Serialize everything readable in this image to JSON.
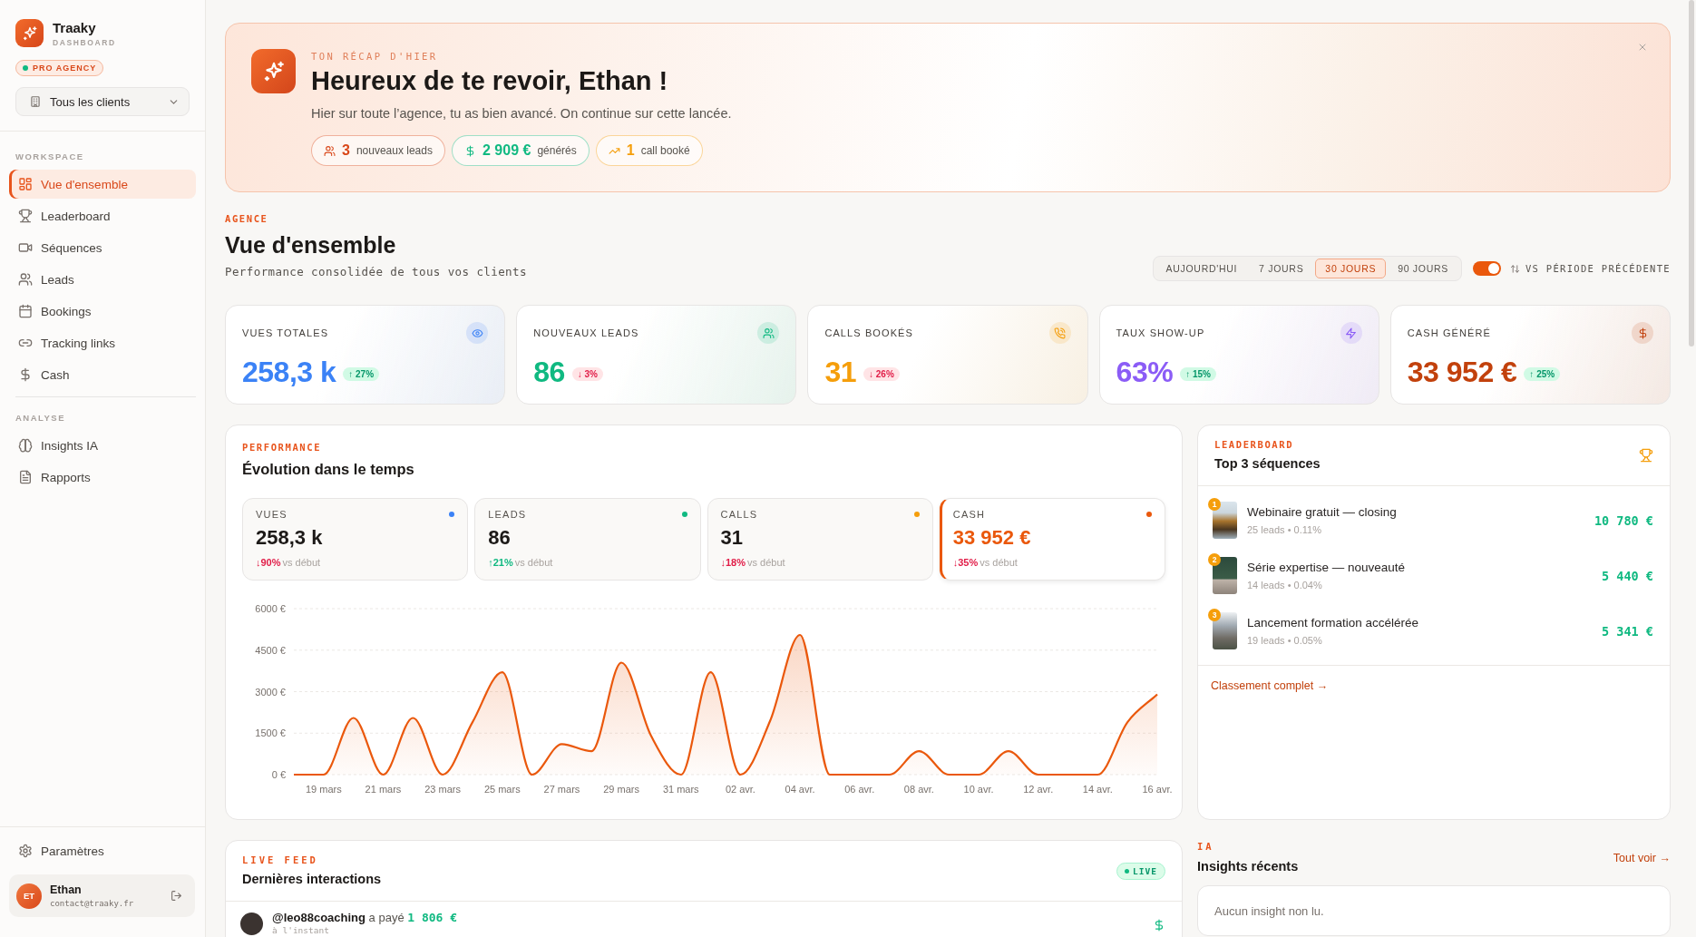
{
  "sidebar": {
    "brand": {
      "name": "Traaky",
      "subtitle": "DASHBOARD"
    },
    "plan_badge": "PRO AGENCY",
    "client_select": {
      "value": "Tous les clients"
    },
    "sections": [
      {
        "title": "WORKSPACE",
        "items": [
          {
            "label": "Vue d'ensemble",
            "selected": true
          },
          {
            "label": "Leaderboard",
            "selected": false
          },
          {
            "label": "Séquences",
            "selected": false
          },
          {
            "label": "Leads",
            "selected": false
          },
          {
            "label": "Bookings",
            "selected": false
          },
          {
            "label": "Tracking links",
            "selected": false
          },
          {
            "label": "Cash",
            "selected": false
          }
        ]
      },
      {
        "title": "ANALYSE",
        "items": [
          {
            "label": "Insights IA",
            "selected": false
          },
          {
            "label": "Rapports",
            "selected": false
          }
        ]
      }
    ],
    "settings": "Paramètres",
    "user": {
      "initials": "ET",
      "name": "Ethan",
      "email": "contact@traaky.fr"
    }
  },
  "banner": {
    "eyebrow": "TON RÉCAP D'HIER",
    "title": "Heureux de te revoir, Ethan !",
    "subtitle": "Hier sur toute l’agence, tu as bien avancé. On continue sur cette lancée.",
    "chips": [
      {
        "value": "3",
        "label": "nouveaux leads",
        "color": "#d9481a"
      },
      {
        "value": "2 909 €",
        "label": "générés",
        "color": "#10b981"
      },
      {
        "value": "1",
        "label": "call booké",
        "color": "#f59e0b"
      }
    ]
  },
  "header": {
    "eyebrow": "AGENCE",
    "title": "Vue d'ensemble",
    "subtitle": "Performance consolidée de tous vos clients",
    "periods": [
      {
        "label": "AUJOURD'HUI",
        "selected": false
      },
      {
        "label": "7 JOURS",
        "selected": false
      },
      {
        "label": "30 JOURS",
        "selected": true
      },
      {
        "label": "90 JOURS",
        "selected": false
      }
    ],
    "compare": {
      "on": true,
      "label": "VS PÉRIODE PRÉCÉDENTE"
    }
  },
  "kpis": [
    {
      "label": "VUES TOTALES",
      "value": "258,3 k",
      "delta": "↑ 27%",
      "positive": true,
      "color": "#3b82f6"
    },
    {
      "label": "NOUVEAUX LEADS",
      "value": "86",
      "delta": "↓ 3%",
      "positive": false,
      "color": "#10b981"
    },
    {
      "label": "CALLS BOOKÉS",
      "value": "31",
      "delta": "↓ 26%",
      "positive": false,
      "color": "#f59e0b"
    },
    {
      "label": "TAUX SHOW-UP",
      "value": "63%",
      "delta": "↑ 15%",
      "positive": true,
      "color": "#8b5cf6"
    },
    {
      "label": "CASH GÉNÉRÉ",
      "value": "33 952 €",
      "delta": "↑ 25%",
      "positive": true,
      "color": "#c2410c"
    }
  ],
  "performance": {
    "eyebrow": "PERFORMANCE",
    "title": "Évolution dans le temps",
    "metrics": [
      {
        "label": "VUES",
        "value": "258,3 k",
        "delta": "↓90%",
        "positive": false,
        "note": "vs début",
        "color": "#3b82f6",
        "selected": false
      },
      {
        "label": "LEADS",
        "value": "86",
        "delta": "↑21%",
        "positive": true,
        "note": "vs début",
        "color": "#10b981",
        "selected": false
      },
      {
        "label": "CALLS",
        "value": "31",
        "delta": "↓18%",
        "positive": false,
        "note": "vs début",
        "color": "#f59e0b",
        "selected": false
      },
      {
        "label": "CASH",
        "value": "33 952 €",
        "delta": "↓35%",
        "positive": false,
        "note": "vs début",
        "color": "#ea580c",
        "selected": true
      }
    ],
    "chart_data": {
      "type": "area",
      "grid": true,
      "categories": [
        null,
        "19 mars",
        null,
        "21 mars",
        null,
        "23 mars",
        null,
        "25 mars",
        null,
        "27 mars",
        null,
        "29 mars",
        null,
        "31 mars",
        null,
        "02 avr.",
        null,
        "04 avr.",
        null,
        "06 avr.",
        null,
        "08 avr.",
        null,
        "10 avr.",
        null,
        "12 avr.",
        null,
        "14 avr.",
        null,
        "16 avr."
      ],
      "values": [
        0,
        0,
        2050,
        0,
        2050,
        0,
        1900,
        3700,
        0,
        1100,
        850,
        4050,
        1400,
        0,
        3700,
        0,
        1950,
        5050,
        0,
        0,
        0,
        850,
        0,
        0,
        850,
        0,
        0,
        0,
        1900,
        2900
      ],
      "ylim": [
        0,
        6000
      ],
      "yticks": [
        {
          "value": 0,
          "label": "0 €"
        },
        {
          "value": 1500,
          "label": "1500 €"
        },
        {
          "value": 3000,
          "label": "3000 €"
        },
        {
          "value": 4500,
          "label": "4500 €"
        },
        {
          "value": 6000,
          "label": "6000 €"
        }
      ]
    }
  },
  "leaderboard": {
    "eyebrow": "LEADERBOARD",
    "title": "Top 3 séquences",
    "rows": [
      {
        "rank": "1",
        "name": "Webinaire gratuit — closing",
        "meta": "25 leads • 0.11%",
        "value": "10 780 €"
      },
      {
        "rank": "2",
        "name": "Série expertise — nouveauté",
        "meta": "14 leads • 0.04%",
        "value": "5 440 €"
      },
      {
        "rank": "3",
        "name": "Lancement formation accélérée",
        "meta": "19 leads • 0.05%",
        "value": "5 341 €"
      }
    ],
    "link": "Classement complet →"
  },
  "live_feed": {
    "eyebrow": "LIVE FEED",
    "title": "Dernières interactions",
    "badge": "LIVE",
    "items": [
      {
        "text": "**@leo88coaching** a payé **1 806 €**",
        "time": "à l'instant"
      }
    ]
  },
  "insights": {
    "eyebrow": "IA",
    "title": "Insights récents",
    "link": "Tout voir →",
    "empty": "Aucun insight non lu."
  }
}
